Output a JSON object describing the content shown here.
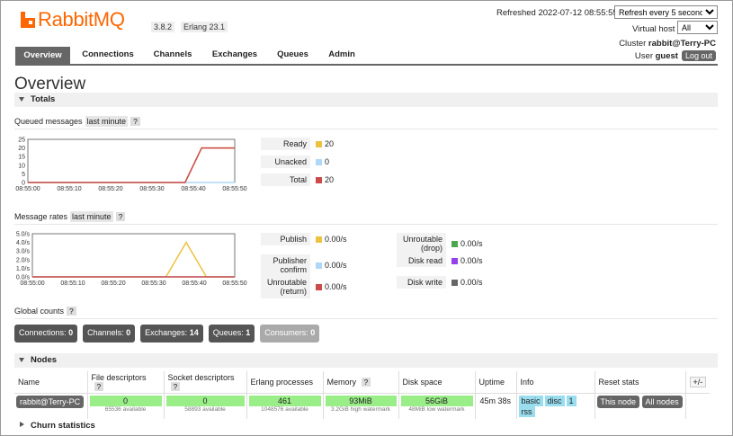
{
  "app": {
    "logo_text": "RabbitMQ",
    "version": "3.8.2",
    "erlang": "Erlang 23.1",
    "refreshed": "Refreshed 2022-07-12 08:55:55",
    "refresh_option": "Refresh every 5 seconds",
    "vhost_label": "Virtual host",
    "vhost_value": "All",
    "cluster_label": "Cluster",
    "cluster_name": "rabbit@Terry-PC",
    "user_label": "User",
    "user_name": "guest",
    "logout": "Log out"
  },
  "tabs": [
    "Overview",
    "Connections",
    "Channels",
    "Exchanges",
    "Queues",
    "Admin"
  ],
  "page_title": "Overview",
  "totals_title": "Totals",
  "queued": {
    "label": "Queued messages",
    "range": "last minute",
    "help": "?",
    "legend": [
      {
        "label": "Ready",
        "value": "20",
        "color": "#edc240"
      },
      {
        "label": "Unacked",
        "value": "0",
        "color": "#afd8f8"
      },
      {
        "label": "Total",
        "value": "20",
        "color": "#cb4b4b"
      }
    ]
  },
  "rates": {
    "label": "Message rates",
    "range": "last minute",
    "help": "?",
    "legend_left": [
      {
        "label": "Publish",
        "value": "0.00/s",
        "color": "#edc240"
      },
      {
        "label": "Publisher confirm",
        "value": "0.00/s",
        "color": "#afd8f8"
      },
      {
        "label": "Unroutable (return)",
        "value": "0.00/s",
        "color": "#cb4b4b"
      }
    ],
    "legend_right": [
      {
        "label": "Unroutable (drop)",
        "value": "0.00/s",
        "color": "#4da74d"
      },
      {
        "label": "Disk read",
        "value": "0.00/s",
        "color": "#9440ed"
      },
      {
        "label": "Disk write",
        "value": "0.00/s",
        "color": "#666666"
      }
    ]
  },
  "global_counts": {
    "label": "Global counts",
    "help": "?",
    "items": [
      {
        "label": "Connections:",
        "value": "0"
      },
      {
        "label": "Channels:",
        "value": "0"
      },
      {
        "label": "Exchanges:",
        "value": "14"
      },
      {
        "label": "Queues:",
        "value": "1"
      },
      {
        "label": "Consumers:",
        "value": "0"
      }
    ]
  },
  "nodes_title": "Nodes",
  "nodes": {
    "headers": [
      "Name",
      "File descriptors",
      "Socket descriptors",
      "Erlang processes",
      "Memory",
      "Disk space",
      "Uptime",
      "Info",
      "Reset stats"
    ],
    "help": "?",
    "plus_minus": "+/-",
    "row": {
      "name": "rabbit@Terry-PC",
      "fd": "0",
      "fd_sub": "65536 available",
      "sd": "0",
      "sd_sub": "58893 available",
      "ep": "461",
      "ep_sub": "1048576 available",
      "mem": "93MiB",
      "mem_sub": "3.2GiB high watermark",
      "disk": "56GiB",
      "disk_sub": "48MiB low watermark",
      "uptime": "45m 38s",
      "info": [
        "basic",
        "disc",
        "1",
        "rss"
      ],
      "reset_this": "This node",
      "reset_all": "All nodes"
    }
  },
  "churn_title": "Churn statistics",
  "chart_data": [
    {
      "type": "line",
      "title": "Queued messages",
      "x": [
        "08:55:00",
        "08:55:10",
        "08:55:20",
        "08:55:30",
        "08:55:40",
        "08:55:50"
      ],
      "ylim": [
        0,
        25
      ],
      "yticks": [
        "0",
        "5",
        "10",
        "15",
        "20",
        "25"
      ],
      "series": [
        {
          "name": "Ready",
          "color": "#edc240",
          "points": [
            [
              0,
              0
            ],
            [
              38,
              0
            ],
            [
              42,
              20
            ],
            [
              50,
              20
            ]
          ]
        },
        {
          "name": "Unacked",
          "color": "#afd8f8",
          "points": [
            [
              0,
              0
            ],
            [
              50,
              0
            ]
          ]
        },
        {
          "name": "Total",
          "color": "#cb4b4b",
          "points": [
            [
              0,
              0
            ],
            [
              38,
              0
            ],
            [
              42,
              20
            ],
            [
              50,
              20
            ]
          ]
        }
      ]
    },
    {
      "type": "line",
      "title": "Message rates",
      "x": [
        "08:55:00",
        "08:55:10",
        "08:55:20",
        "08:55:30",
        "08:55:40",
        "08:55:50"
      ],
      "ylim": [
        0,
        5
      ],
      "yticks": [
        "0.0/s",
        "1.0/s",
        "2.0/s",
        "3.0/s",
        "4.0/s",
        "5.0/s"
      ],
      "series": [
        {
          "name": "Publish",
          "color": "#edc240",
          "points": [
            [
              0,
              0
            ],
            [
              33,
              0
            ],
            [
              38,
              4
            ],
            [
              43,
              0
            ],
            [
              50,
              0
            ]
          ]
        },
        {
          "name": "Publisher confirm",
          "color": "#afd8f8",
          "points": [
            [
              0,
              0
            ],
            [
              50,
              0
            ]
          ]
        },
        {
          "name": "Unroutable (return)",
          "color": "#cb4b4b",
          "points": [
            [
              0,
              0
            ],
            [
              50,
              0
            ]
          ]
        }
      ]
    }
  ]
}
